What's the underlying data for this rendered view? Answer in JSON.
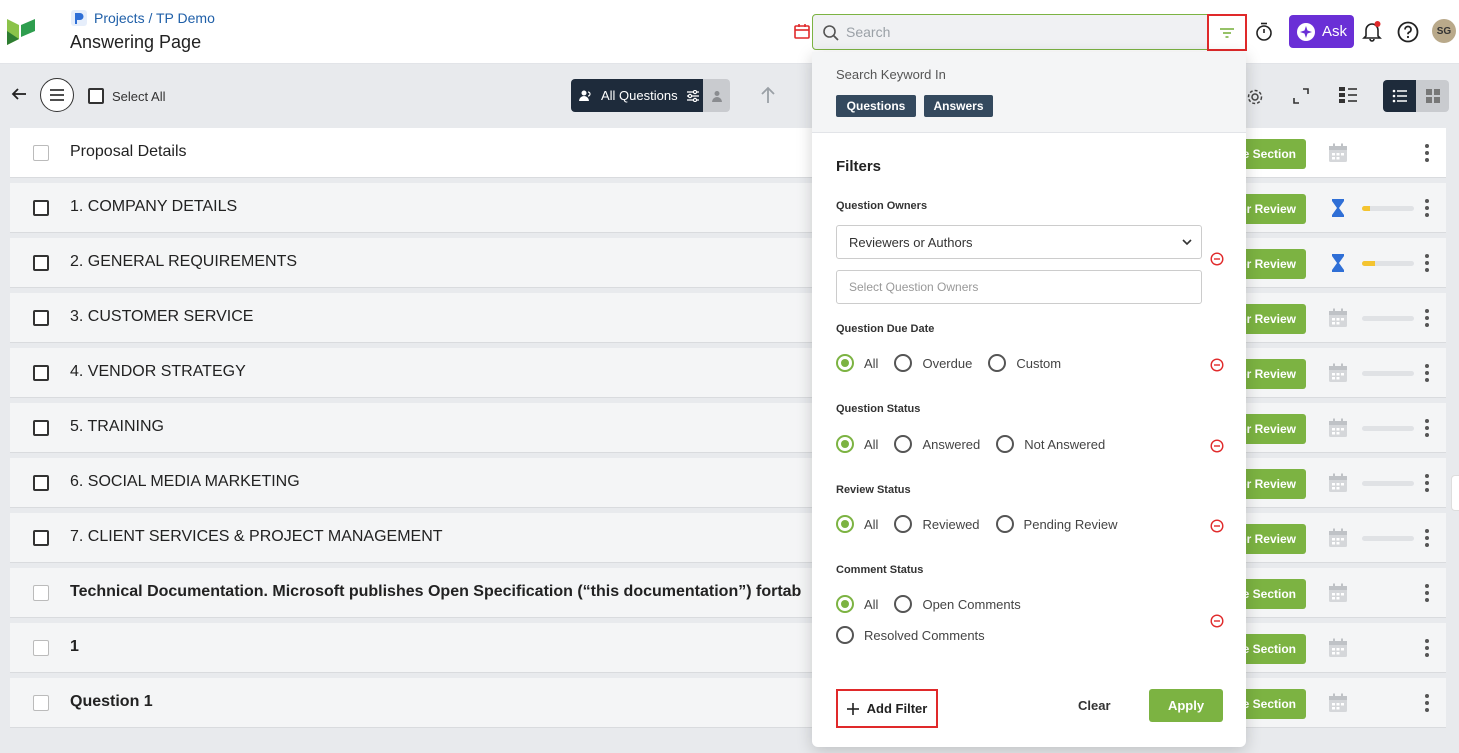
{
  "header": {
    "breadcrumb": "Projects / TP Demo",
    "page_title": "Answering Page",
    "search_placeholder": "Search",
    "ask_label": "Ask",
    "avatar_initials": "SG"
  },
  "toolbar": {
    "select_all": "Select All",
    "all_questions": "All Questions"
  },
  "rows": [
    {
      "label": "Proposal Details",
      "button": "te Section",
      "type": "section",
      "progress": null
    },
    {
      "label": "1. COMPANY DETAILS",
      "button": "for Review",
      "type": "review",
      "progress": 0.15
    },
    {
      "label": "2. GENERAL REQUIREMENTS",
      "button": "for Review",
      "type": "review",
      "progress": 0.25
    },
    {
      "label": "3. CUSTOMER SERVICE",
      "button": "for Review",
      "type": "review-cal",
      "progress": 0
    },
    {
      "label": "4. VENDOR STRATEGY",
      "button": "for Review",
      "type": "review-cal",
      "progress": 0
    },
    {
      "label": "5. TRAINING",
      "button": "for Review",
      "type": "review-cal",
      "progress": 0
    },
    {
      "label": "6. SOCIAL MEDIA MARKETING",
      "button": "for Review",
      "type": "review-cal",
      "progress": 0
    },
    {
      "label": "7. CLIENT SERVICES & PROJECT MANAGEMENT",
      "button": "for Review",
      "type": "review-cal",
      "progress": 0
    },
    {
      "label": "Technical Documentation. Microsoft publishes Open Specification (“this documentation”) fortab",
      "button": "te Section",
      "type": "section",
      "progress": null
    },
    {
      "label": "1",
      "button": "te Section",
      "type": "section",
      "progress": null
    },
    {
      "label": "Question 1",
      "button": "te Section",
      "type": "section",
      "progress": null
    }
  ],
  "popover": {
    "search_keyword_in": "Search Keyword In",
    "chips": [
      "Questions",
      "Answers"
    ],
    "filters_title": "Filters",
    "question_owners": {
      "label": "Question Owners",
      "selected": "Reviewers or Authors",
      "placeholder": "Select Question Owners"
    },
    "due_date": {
      "label": "Question Due Date",
      "options": [
        "All",
        "Overdue",
        "Custom"
      ],
      "selected": "All"
    },
    "question_status": {
      "label": "Question Status",
      "options": [
        "All",
        "Answered",
        "Not Answered"
      ],
      "selected": "All"
    },
    "review_status": {
      "label": "Review Status",
      "options": [
        "All",
        "Reviewed",
        "Pending Review"
      ],
      "selected": "All"
    },
    "comment_status": {
      "label": "Comment Status",
      "options": [
        "All",
        "Open Comments",
        "Resolved Comments"
      ],
      "selected": "All"
    },
    "add_filter": "Add Filter",
    "clear": "Clear",
    "apply": "Apply"
  },
  "colors": {
    "accent_green": "#7cb342",
    "navy": "#1e2b3b",
    "ask_purple": "#6a2fd6",
    "highlight_red": "#e0292a"
  }
}
